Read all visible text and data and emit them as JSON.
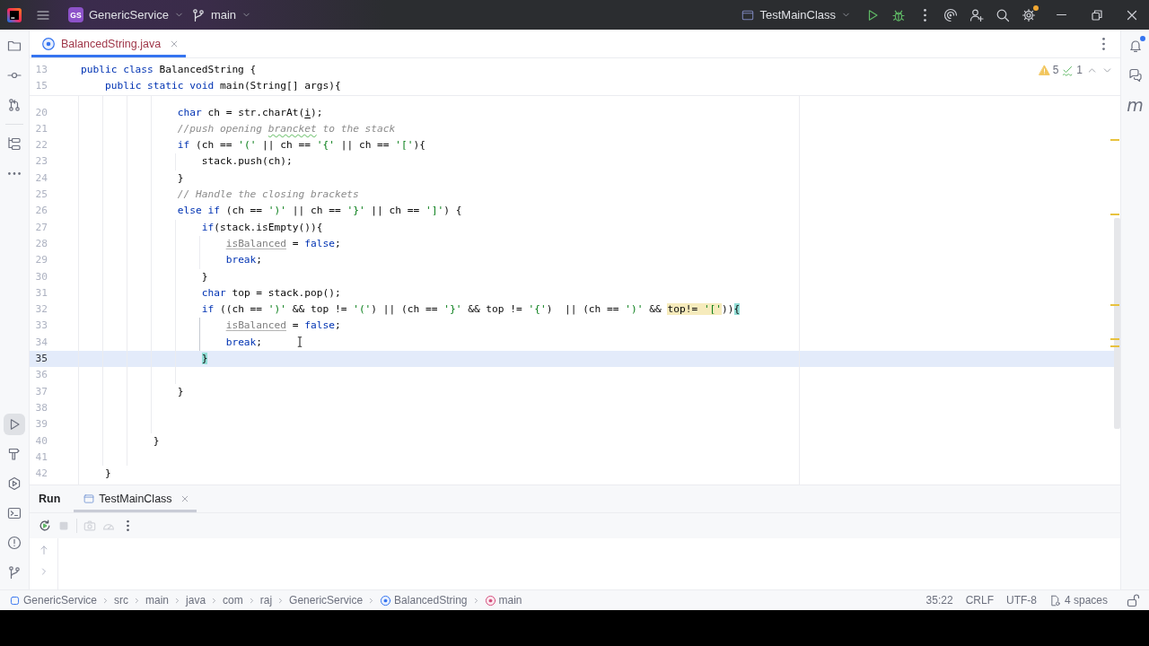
{
  "title_bar": {
    "project": {
      "initials": "GS",
      "name": "GenericService"
    },
    "branch": "main",
    "run_configuration": "TestMainClass",
    "settings_badge": true
  },
  "left_toolbar": {
    "top": [
      {
        "kind": "project",
        "selected": false
      },
      {
        "kind": "commit",
        "selected": false
      },
      {
        "kind": "pull_requests",
        "selected": false
      },
      {
        "kind": "structure",
        "selected": false
      },
      {
        "kind": "more",
        "selected": false
      }
    ],
    "bottom": [
      {
        "kind": "run",
        "selected": true
      },
      {
        "kind": "build",
        "selected": false
      },
      {
        "kind": "services",
        "selected": false
      },
      {
        "kind": "terminal",
        "selected": false
      },
      {
        "kind": "problems",
        "selected": false
      },
      {
        "kind": "git",
        "selected": false
      }
    ]
  },
  "editor_tabs": [
    {
      "label": "BalancedString.java",
      "selected": true
    }
  ],
  "right_toolbar": [
    {
      "kind": "notifications",
      "badge": true
    },
    {
      "kind": "ai_chat",
      "badge": false
    },
    {
      "kind": "maven",
      "glyph": "m",
      "badge": false
    }
  ],
  "inspections": {
    "warnings": "5",
    "typos": "1"
  },
  "sticky_lines": [
    {
      "number": "13",
      "tokens": [
        {
          "text": "public class",
          "kind": "keyword"
        },
        {
          "text": " BalancedString {",
          "kind": "plain"
        }
      ]
    },
    {
      "number": "15",
      "tokens": [
        {
          "text": "    public static void",
          "kind": "keyword"
        },
        {
          "text": " main(String[] args){",
          "kind": "plain"
        }
      ]
    }
  ],
  "lines": [
    {
      "number": "20",
      "current": false,
      "tokens": [
        {
          "text": "                char",
          "kind": "keyword"
        },
        {
          "text": " ch = str.charAt(",
          "kind": "plain"
        },
        {
          "text": "i",
          "kind": "reassigned"
        },
        {
          "text": ");",
          "kind": "plain"
        }
      ]
    },
    {
      "number": "21",
      "current": false,
      "tokens": [
        {
          "text": "                //push opening ",
          "kind": "comment"
        },
        {
          "text": "brancket",
          "kind": "typo"
        },
        {
          "text": " to the stack",
          "kind": "comment"
        }
      ]
    },
    {
      "number": "22",
      "current": false,
      "tokens": [
        {
          "text": "                if",
          "kind": "keyword"
        },
        {
          "text": " (ch == ",
          "kind": "plain"
        },
        {
          "text": "'('",
          "kind": "string"
        },
        {
          "text": " || ch == ",
          "kind": "plain"
        },
        {
          "text": "'{'",
          "kind": "string"
        },
        {
          "text": " || ch == ",
          "kind": "plain"
        },
        {
          "text": "'['",
          "kind": "string"
        },
        {
          "text": "){",
          "kind": "plain"
        }
      ]
    },
    {
      "number": "23",
      "current": false,
      "tokens": [
        {
          "text": "                    stack.push(ch);",
          "kind": "plain"
        }
      ]
    },
    {
      "number": "24",
      "current": false,
      "tokens": [
        {
          "text": "                }",
          "kind": "plain"
        }
      ]
    },
    {
      "number": "25",
      "current": false,
      "tokens": [
        {
          "text": "                // Handle the closing brackets",
          "kind": "comment"
        }
      ]
    },
    {
      "number": "26",
      "current": false,
      "tokens": [
        {
          "text": "                else if",
          "kind": "keyword"
        },
        {
          "text": " (ch == ",
          "kind": "plain"
        },
        {
          "text": "')'",
          "kind": "string"
        },
        {
          "text": " || ch == ",
          "kind": "plain"
        },
        {
          "text": "'}'",
          "kind": "string"
        },
        {
          "text": " || ch == ",
          "kind": "plain"
        },
        {
          "text": "']'",
          "kind": "string"
        },
        {
          "text": ") {",
          "kind": "plain"
        }
      ]
    },
    {
      "number": "27",
      "current": false,
      "tokens": [
        {
          "text": "                    if",
          "kind": "keyword"
        },
        {
          "text": "(stack.isEmpty()){",
          "kind": "plain"
        }
      ]
    },
    {
      "number": "28",
      "current": false,
      "tokens": [
        {
          "text": "                        isBalanced",
          "kind": "unused"
        },
        {
          "text": " = ",
          "kind": "plain"
        },
        {
          "text": "false",
          "kind": "keyword"
        },
        {
          "text": ";",
          "kind": "plain"
        }
      ]
    },
    {
      "number": "29",
      "current": false,
      "tokens": [
        {
          "text": "                        break",
          "kind": "keyword"
        },
        {
          "text": ";",
          "kind": "plain"
        }
      ]
    },
    {
      "number": "30",
      "current": false,
      "tokens": [
        {
          "text": "                    }",
          "kind": "plain"
        }
      ]
    },
    {
      "number": "31",
      "current": false,
      "tokens": [
        {
          "text": "                    char",
          "kind": "keyword"
        },
        {
          "text": " top = stack.pop();",
          "kind": "plain"
        }
      ]
    },
    {
      "number": "32",
      "current": false,
      "tokens": [
        {
          "text": "                    if",
          "kind": "keyword"
        },
        {
          "text": " ((ch == ",
          "kind": "plain"
        },
        {
          "text": "')'",
          "kind": "string"
        },
        {
          "text": " && top != ",
          "kind": "plain"
        },
        {
          "text": "'('",
          "kind": "string"
        },
        {
          "text": ") || (ch == ",
          "kind": "plain"
        },
        {
          "text": "'}'",
          "kind": "string"
        },
        {
          "text": " && top != ",
          "kind": "plain"
        },
        {
          "text": "'{'",
          "kind": "string"
        },
        {
          "text": ")  || (ch == ",
          "kind": "plain"
        },
        {
          "text": "')'",
          "kind": "string"
        },
        {
          "text": " && ",
          "kind": "plain"
        },
        {
          "text": "top!= ",
          "kind": "warn"
        },
        {
          "text": "'['",
          "kind": "warnstring"
        },
        {
          "text": "))",
          "kind": "plain"
        },
        {
          "text": "{",
          "kind": "brace"
        }
      ]
    },
    {
      "number": "33",
      "current": false,
      "tokens": [
        {
          "text": "                        isBalanced",
          "kind": "unused"
        },
        {
          "text": " = ",
          "kind": "plain"
        },
        {
          "text": "false",
          "kind": "keyword"
        },
        {
          "text": ";",
          "kind": "plain"
        }
      ]
    },
    {
      "number": "34",
      "current": false,
      "tokens": [
        {
          "text": "                        break",
          "kind": "keyword"
        },
        {
          "text": ";",
          "kind": "plain"
        }
      ]
    },
    {
      "number": "35",
      "current": true,
      "tokens": [
        {
          "text": "                    }",
          "kind": "brace"
        }
      ]
    },
    {
      "number": "36",
      "current": false
    },
    {
      "number": "37",
      "current": false,
      "tokens": [
        {
          "text": "                }",
          "kind": "plain"
        }
      ]
    },
    {
      "number": "38",
      "current": false
    },
    {
      "number": "39",
      "current": false
    },
    {
      "number": "40",
      "current": false,
      "tokens": [
        {
          "text": "            }",
          "kind": "plain"
        }
      ]
    },
    {
      "number": "41",
      "current": false
    },
    {
      "number": "42",
      "current": false,
      "tokens": [
        {
          "text": "    }",
          "kind": "plain"
        }
      ]
    }
  ],
  "run_panel": {
    "title": "Run",
    "tabs": [
      {
        "label": "TestMainClass",
        "selected": true
      }
    ],
    "actions": [
      {
        "kind": "rerun",
        "disabled": false
      },
      {
        "kind": "stop",
        "disabled": true
      },
      {
        "kind": "screenshot",
        "disabled": true
      },
      {
        "kind": "profiler",
        "disabled": true
      },
      {
        "kind": "more",
        "disabled": false
      }
    ]
  },
  "status_bar": {
    "breadcrumbs": [
      {
        "label": "GenericService",
        "kind": "module"
      },
      {
        "label": "src",
        "kind": "plain"
      },
      {
        "label": "main",
        "kind": "plain"
      },
      {
        "label": "java",
        "kind": "plain"
      },
      {
        "label": "com",
        "kind": "plain"
      },
      {
        "label": "raj",
        "kind": "plain"
      },
      {
        "label": "GenericService",
        "kind": "plain"
      },
      {
        "label": "BalancedString",
        "kind": "class"
      },
      {
        "label": "main",
        "kind": "method"
      }
    ],
    "caret_position": "35:22",
    "line_separator": "CRLF",
    "encoding": "UTF-8",
    "indentation": "4 spaces",
    "read_only": false
  }
}
